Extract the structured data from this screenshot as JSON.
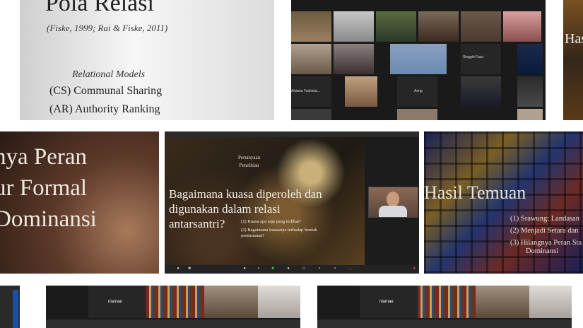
{
  "slide_pola": {
    "title": "Pola Relasi",
    "citation": "(Fiske, 1999; Rai & Fiske, 2011)",
    "subtitle": "Relational Models",
    "items": [
      "(CS) Communal Sharing",
      "(AR) Authority Ranking"
    ]
  },
  "zoom_gallery": {
    "names": [
      "Singgih Fazri",
      "Aong",
      "Aisiana Yoshinta..."
    ]
  },
  "edge_right": {
    "text": "Has"
  },
  "slide_peran": {
    "lines": [
      "nya Peran",
      "ur Formal",
      "Dominansi"
    ]
  },
  "meeting": {
    "heading": [
      "Pertanyaan",
      "Penelitian"
    ],
    "question": "Bagaimana kuasa diperoleh dan digunakan dalam relasi antarsantri?",
    "items": [
      "(1)  Kuasa apa saja yang terlibat?",
      "(2)  Bagaimana kuasanya terhadap bentuk pertemanan?"
    ]
  },
  "slide_hasil": {
    "title": "Hasil Temuan",
    "items": [
      "(1)  Srawung: Landasan",
      "(2)  Menjadi Setara dan",
      "(3)  Hilangnya Peran Sta",
      "Dominansi"
    ]
  },
  "bottom_gallery": {
    "name": "niamae"
  }
}
